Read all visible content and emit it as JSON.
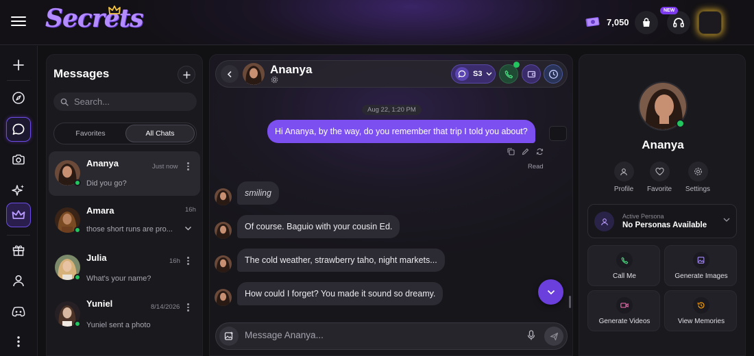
{
  "app": {
    "logo_text": "Secrets",
    "coins": "7,050",
    "new_badge": "NEW"
  },
  "messages_panel": {
    "title": "Messages",
    "search_placeholder": "Search...",
    "tabs": [
      "Favorites",
      "All Chats"
    ],
    "active_tab": "All Chats",
    "chats": [
      {
        "name": "Ananya",
        "time": "Just now",
        "preview": "Did you go?",
        "online": true,
        "selected": true
      },
      {
        "name": "Amara",
        "time": "16h",
        "preview": "those short runs are pro...",
        "online": true,
        "selected": false
      },
      {
        "name": "Julia",
        "time": "16h",
        "preview": "What's your name?",
        "online": true,
        "selected": false
      },
      {
        "name": "Yuniel",
        "time": "8/14/2026",
        "preview": "Yuniel sent a photo",
        "online": true,
        "selected": false
      }
    ]
  },
  "chat": {
    "contact_name": "Ananya",
    "scenario_label": "S3",
    "date_stamp": "Aug 22, 1:20 PM",
    "outgoing": {
      "text": "Hi Ananya, by the way, do you remember that trip I told you about?",
      "status": "Read"
    },
    "incoming": [
      {
        "text": "smiling",
        "italic": true
      },
      {
        "text": "Of course. Baguio with your cousin Ed.",
        "italic": false
      },
      {
        "text": "The cold weather, strawberry taho, night markets...",
        "italic": false
      },
      {
        "text": "How could I forget? You made it sound so dreamy.",
        "italic": false
      }
    ],
    "composer_placeholder": "Message Ananya..."
  },
  "profile": {
    "name": "Ananya",
    "online": true,
    "actions": [
      "Profile",
      "Favorite",
      "Settings"
    ],
    "persona_label": "Active Persona",
    "persona_value": "No Personas Available",
    "tiles": [
      "Call Me",
      "Generate Images",
      "Generate Videos",
      "View Memories"
    ]
  },
  "colors": {
    "accent": "#7c4ff0",
    "online": "#22c55e",
    "background": "#111013",
    "panel": "#1a191e"
  },
  "icons": {
    "rail": [
      "plus-icon",
      "compass-icon",
      "chat-icon",
      "camera-icon",
      "sparkles-icon",
      "crown-icon",
      "gift-icon",
      "user-icon",
      "gamepad-icon",
      "more-vertical-icon"
    ],
    "header": [
      "coin-icon",
      "shopping-bag-icon",
      "headset-icon"
    ]
  }
}
